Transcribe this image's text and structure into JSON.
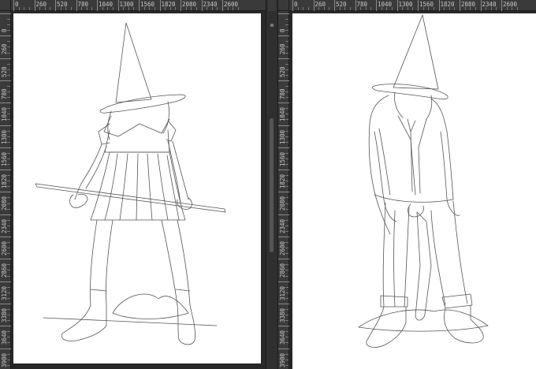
{
  "window": {
    "title": ""
  },
  "rulers": {
    "left": {
      "horizontal": [
        "0",
        "260",
        "520",
        "780",
        "1040",
        "1300",
        "1560",
        "1820",
        "2080",
        "2340",
        "2600"
      ],
      "vertical": [
        "0",
        "260",
        "520",
        "780",
        "1040",
        "1300",
        "1560",
        "1820",
        "2080",
        "2340",
        "2600",
        "2860",
        "3120",
        "3380",
        "3640",
        "3900"
      ]
    },
    "right": {
      "horizontal": [
        "0",
        "260",
        "520",
        "780",
        "1040",
        "1300",
        "1560",
        "1820",
        "2080",
        "2340",
        "2600"
      ],
      "vertical": [
        "0",
        "260",
        "520",
        "780",
        "1040",
        "1300",
        "1560",
        "1820",
        "2080",
        "2340",
        "2600",
        "2860",
        "3120",
        "3380",
        "3640",
        "3900"
      ]
    }
  },
  "documents": [
    {
      "subject": "girl-in-witch-hat-line-art"
    },
    {
      "subject": "boy-in-witch-hat-line-art"
    }
  ],
  "colors": {
    "workspace": "#282828",
    "ruler": "#3a3a3a",
    "canvas": "#ffffff",
    "line": "#555555"
  }
}
